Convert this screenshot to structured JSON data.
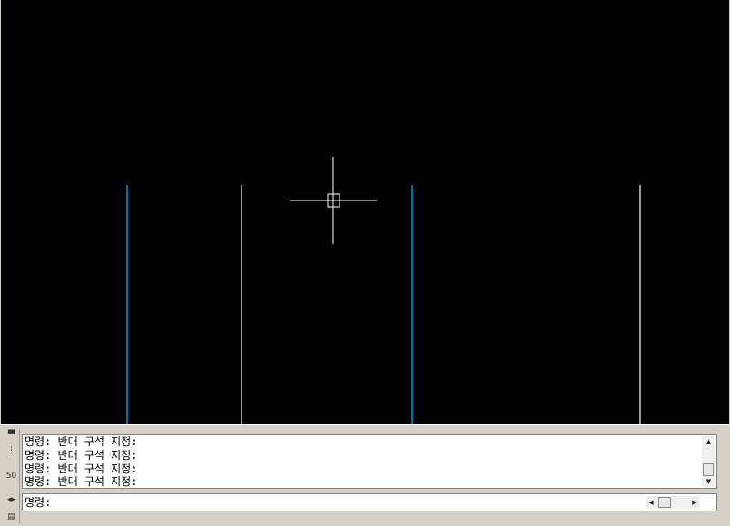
{
  "command_window": {
    "history": [
      "명령: 반대 구석 지정:",
      "명령: 반대 구석 지정:",
      "명령: 반대 구석 지정:",
      "명령: 반대 구석 지정:"
    ],
    "prompt": "명령:",
    "input_value": "",
    "sidebar_number": "50"
  },
  "icons": {
    "pin": "pin-icon",
    "properties": "properties-icon",
    "arrows": "resize-arrows-icon",
    "list": "list-icon",
    "scroll_up": "scroll-up-icon",
    "scroll_down": "scroll-down-icon",
    "scroll_left": "scroll-left-icon",
    "scroll_right": "scroll-right-icon"
  },
  "colors": {
    "canvas": "#000000",
    "cyan_line": "#00bfff",
    "white_line": "#ffffff",
    "crosshair": "#ffffff"
  }
}
